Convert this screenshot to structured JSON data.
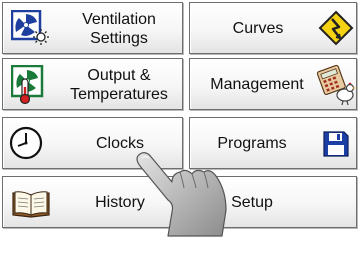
{
  "menu": {
    "ventilation_settings": {
      "line1": "Ventilation",
      "line2": "Settings"
    },
    "curves": {
      "label": "Curves"
    },
    "output_temperatures": {
      "line1": "Output &",
      "line2": "Temperatures"
    },
    "management": {
      "label": "Management"
    },
    "clocks": {
      "label": "Clocks"
    },
    "programs": {
      "label": "Programs"
    },
    "history": {
      "label": "History"
    },
    "setup": {
      "label": "Setup"
    }
  },
  "icons": {
    "ventilation": "fan-sun-icon",
    "curves": "curve-warning-icon",
    "output": "fan-thermometer-icon",
    "management": "calculator-chicken-icon",
    "clocks": "clock-icon",
    "programs": "floppy-disk-icon",
    "history": "open-book-icon",
    "pointer": "pointing-hand"
  },
  "colors": {
    "button_border": "#6e6e6e",
    "fan_blue": "#1f3f9e",
    "fan_green": "#1a7a3a",
    "warning_yellow": "#f5d313",
    "floppy_blue": "#1c3fa6"
  }
}
